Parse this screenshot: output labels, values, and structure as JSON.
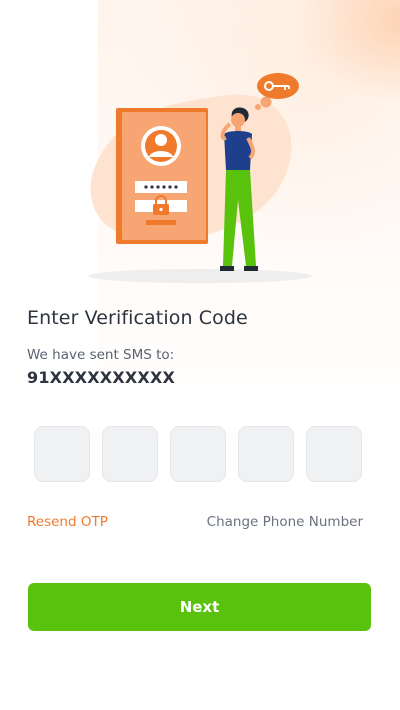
{
  "header": {
    "title": "Enter Verification Code"
  },
  "sms": {
    "label": "We have sent SMS to:",
    "phone": "91XXXXXXXXXX"
  },
  "otp": {
    "digits": [
      "",
      "",
      "",
      "",
      ""
    ]
  },
  "links": {
    "resend": "Resend OTP",
    "change_phone": "Change Phone Number"
  },
  "actions": {
    "next": "Next"
  },
  "colors": {
    "accent_orange": "#f07a2c",
    "primary_green": "#58c20c",
    "input_bg": "#f0f1f3",
    "text_dark": "#2d3440"
  },
  "illustration": {
    "icons": [
      "phone-login-icon",
      "key-thought-icon",
      "lock-icon",
      "user-avatar-icon"
    ]
  }
}
